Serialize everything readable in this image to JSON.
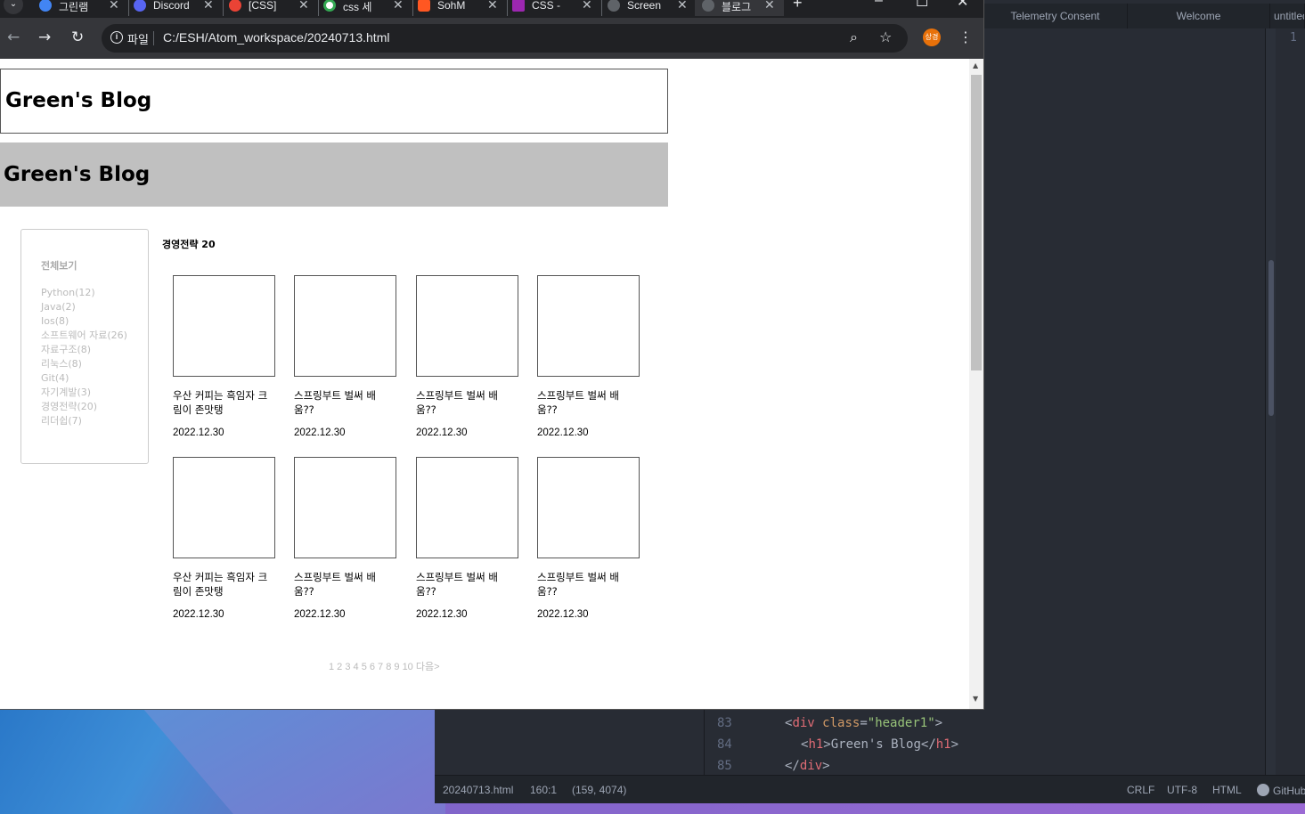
{
  "browser": {
    "tabs": [
      {
        "title": "그린램",
        "favicon_color": "#4285f4"
      },
      {
        "title": "Discord",
        "favicon_color": "#5865f2"
      },
      {
        "title": "[CSS]",
        "favicon_color": "#ea4335"
      },
      {
        "title": "css 세",
        "favicon_color": "#ffffff"
      },
      {
        "title": "SohM",
        "favicon_color": "#ff5722"
      },
      {
        "title": "CSS -",
        "favicon_color": "#9c27b0"
      },
      {
        "title": "Screen",
        "favicon_color": "#5f6368"
      },
      {
        "title": "블로그",
        "favicon_color": "#5f6368",
        "active": true
      }
    ],
    "new_tab": "+",
    "minimize": "–",
    "maximize": "☐",
    "close": "✕",
    "scheme_label": "파일",
    "url": "C:/ESH/Atom_workspace/20240713.html",
    "profile_label": "상경"
  },
  "page": {
    "header1_title": "Green's Blog",
    "header2_title": "Green's Blog",
    "sidebar": {
      "title": "전체보기",
      "items": [
        "Python(12)",
        "Java(2)",
        "Ios(8)",
        "소프트웨어 자료(26)",
        "자료구조(8)",
        "리눅스(8)",
        "Git(4)",
        "자기계발(3)",
        "경영전략(20)",
        "리더쉽(7)"
      ]
    },
    "category_title": "경영전략 20",
    "posts": [
      {
        "title": "우산 커피는 흑임자 크림이 존맛탱",
        "date": "2022.12.30"
      },
      {
        "title": "스프링부트 벌써 배움??",
        "date": "2022.12.30"
      },
      {
        "title": "스프링부트 벌써 배움??",
        "date": "2022.12.30"
      },
      {
        "title": "스프링부트 벌써 배움??",
        "date": "2022.12.30"
      },
      {
        "title": "우산 커피는 흑임자 크림이 존맛탱",
        "date": "2022.12.30"
      },
      {
        "title": "스프링부트 벌써 배움??",
        "date": "2022.12.30"
      },
      {
        "title": "스프링부트 벌써 배움??",
        "date": "2022.12.30"
      },
      {
        "title": "스프링부트 벌써 배움??",
        "date": "2022.12.30"
      }
    ],
    "pagination": "1 2 3 4 5 6 7 8 9 10 다음>"
  },
  "editor": {
    "tabs": [
      "Telemetry Consent",
      "Welcome",
      "untitled"
    ],
    "top_line_number": "1",
    "code_lines": [
      {
        "num": "83",
        "text": "<div class=\"header1\">"
      },
      {
        "num": "84",
        "text": "<h1>Green's Blog</h1>"
      },
      {
        "num": "85",
        "text": "</div>"
      }
    ],
    "status": {
      "file": "20240713.html",
      "cursor": "160:1",
      "position": "(159, 4074)",
      "line_ending": "CRLF",
      "encoding": "UTF-8",
      "grammar": "HTML",
      "github": "GitHub"
    }
  }
}
